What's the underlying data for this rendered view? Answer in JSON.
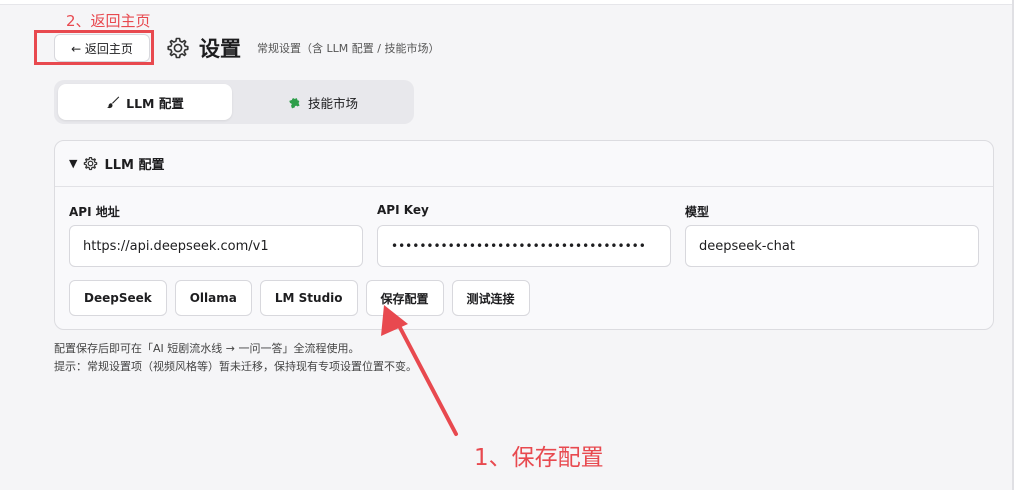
{
  "header": {
    "back_label": "← 返回主页",
    "title": "设置",
    "subtitle": "常规设置（含 LLM 配置 / 技能市场）"
  },
  "tabs": [
    {
      "label": "LLM 配置",
      "icon": "brush-icon",
      "active": true
    },
    {
      "label": "技能市场",
      "icon": "puzzle-icon",
      "active": false
    }
  ],
  "panel": {
    "title": "LLM 配置",
    "collapse_glyph": "▼",
    "fields": [
      {
        "label": "API 地址",
        "value": "https://api.deepseek.com/v1"
      },
      {
        "label": "API Key",
        "value": "••••••••••••••••••••••••••••••••••••"
      },
      {
        "label": "模型",
        "value": "deepseek-chat"
      }
    ],
    "buttons": [
      "DeepSeek",
      "Ollama",
      "LM Studio",
      "保存配置",
      "测试连接"
    ]
  },
  "hints": [
    "配置保存后即可在「AI 短剧流水线 → 一问一答」全流程使用。",
    "提示：常规设置项（视频风格等）暂未迁移，保持现有专项设置位置不变。"
  ],
  "annotations": {
    "back_note": "2、返回主页",
    "save_note": "1、保存配置",
    "color": "#e8494f"
  }
}
